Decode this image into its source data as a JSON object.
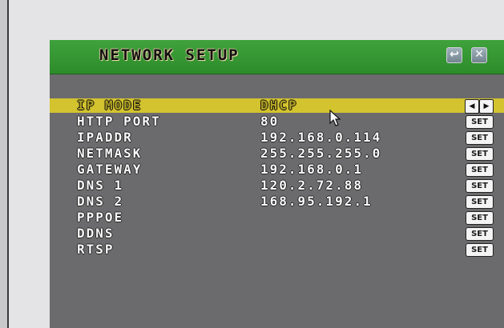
{
  "window": {
    "title": "NETWORK SETUP",
    "back_icon": "↩",
    "close_icon": "✕"
  },
  "rows": [
    {
      "label": "IP MODE",
      "value": "DHCP",
      "control": "arrows",
      "arrow_left": "◀",
      "arrow_right": "▶"
    },
    {
      "label": "HTTP PORT",
      "value": "80",
      "control": "SET"
    },
    {
      "label": "IPADDR",
      "value": "192.168.0.114",
      "control": "SET"
    },
    {
      "label": "NETMASK",
      "value": "255.255.255.0",
      "control": "SET"
    },
    {
      "label": "GATEWAY",
      "value": "192.168.0.1",
      "control": "SET"
    },
    {
      "label": "DNS 1",
      "value": "120.2.72.88",
      "control": "SET"
    },
    {
      "label": "DNS 2",
      "value": "168.95.192.1",
      "control": "SET"
    },
    {
      "label": "PPPOE",
      "value": "",
      "control": "SET"
    },
    {
      "label": "DDNS",
      "value": "",
      "control": "SET"
    },
    {
      "label": "RTSP",
      "value": "",
      "control": "SET"
    }
  ],
  "colors": {
    "titlebar": "#2c8c2a",
    "panel": "#6b6b6d",
    "highlight": "#d3c32f"
  }
}
